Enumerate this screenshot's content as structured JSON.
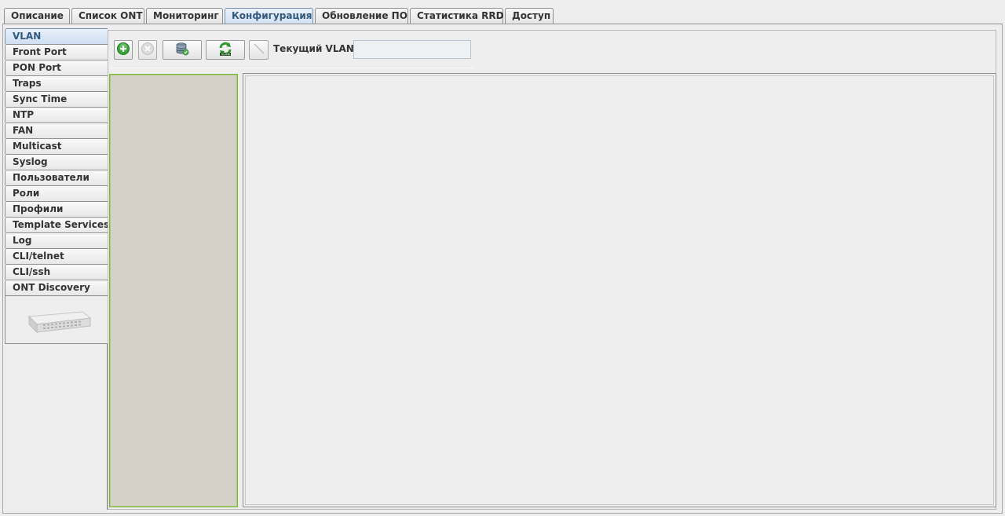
{
  "top_tabs": [
    "Описание",
    "Список ONT",
    "Мониторинг",
    "Конфигурация",
    "Обновление ПО",
    "Статистика RRD",
    "Доступ"
  ],
  "active_top_tab": "Конфигурация",
  "side_tabs": [
    "VLAN",
    "Front Port",
    "PON Port",
    "Traps",
    "Sync Time",
    "NTP",
    "FAN",
    "Multicast",
    "Syslog",
    "Пользователи",
    "Роли",
    "Профили",
    "Template Services",
    "Log",
    "CLI/telnet",
    "CLI/ssh",
    "ONT Discovery"
  ],
  "active_side_tab": "VLAN",
  "toolbar": {
    "current_vlan_label": "Текущий VLAN:",
    "current_vlan_value": "",
    "icons": [
      "add-icon",
      "delete-icon",
      "database-icon",
      "refresh-vlan-icon",
      "edit-icon"
    ]
  },
  "colors": {
    "active_tab": "#d1e0f2",
    "list_background": "#d6d1c8",
    "list_border": "#7fb13d"
  }
}
